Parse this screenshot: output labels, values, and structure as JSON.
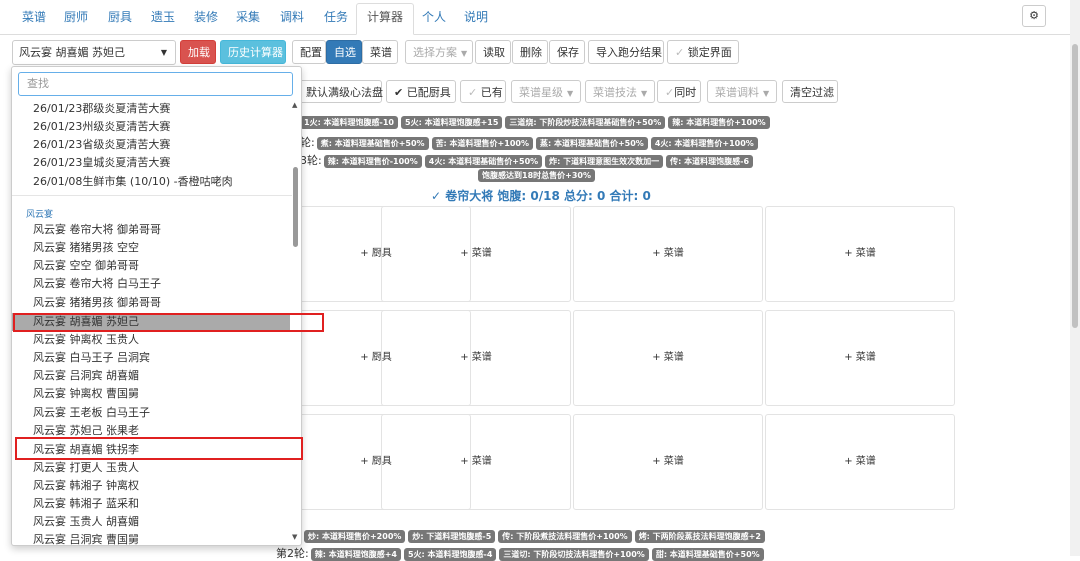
{
  "nav": {
    "tabs": [
      "菜谱",
      "厨师",
      "厨具",
      "遗玉",
      "装修",
      "采集",
      "调料",
      "任务",
      "计算器",
      "个人",
      "说明"
    ],
    "active_index": 8
  },
  "toolbar": {
    "select_value": "风云宴 胡喜媚 苏妲己",
    "load": "加载",
    "history": "历史计算器",
    "config": "配置",
    "autoselect": "自选",
    "recipe": "菜谱",
    "choose_plan": "选择方案",
    "read": "读取",
    "delete": "删除",
    "save": "保存",
    "import": "导入跑分结果",
    "lock": "锁定界面"
  },
  "filters": {
    "default_full": "默认满级心法盘",
    "equipped": "已配厨具",
    "owned": "已有",
    "recipe_star": "菜谱星级",
    "recipe_skill": "菜谱技法",
    "same_time": "同时",
    "recipe_seasoning": "菜谱调料",
    "clear": "清空过滤"
  },
  "rules": {
    "row1": [
      "1火: 本道料理饱腹感-10",
      "5火: 本道料理饱腹感+15",
      "三道烧: 下阶段炒技法料理基础售价+50%",
      "辣: 本道料理售价+100%"
    ],
    "row2_label": "轮:",
    "row2": [
      "煮: 本道料理基础售价+50%",
      "苦: 本道料理售价+100%",
      "蒸: 本道料理基础售价+50%",
      "4火: 本道料理售价+100%"
    ],
    "row3_label": "3轮:",
    "row3": [
      "辣: 本道料理售价-100%",
      "4火: 本道料理基础售价+50%",
      "炸: 下道料理意图生效次数加一",
      "传: 本道料理饱腹感-6"
    ],
    "row4": [
      "饱腹感达到18时总售价+30%"
    ],
    "bottom1": [
      "炒: 本道料理售价+200%",
      "炒: 下道料理饱腹感-5",
      "传: 下阶段煮技法料理售价+100%",
      "烤: 下两阶段蒸技法料理饱腹感+2"
    ],
    "bottom2_label": "第2轮:",
    "bottom2": [
      "辣: 本道料理饱腹感+4",
      "5火: 本道料理饱腹感-4",
      "三道切: 下阶段切技法料理售价+100%",
      "甜: 本道料理基础售价+50%"
    ]
  },
  "summary": "✓ 卷帘大将 饱腹: 0/18 总分: 0 合计: 0",
  "grid": {
    "equip_label": "+ 厨具",
    "recipe_label": "+ 菜谱"
  },
  "dropdown": {
    "search_placeholder": "查找",
    "items_top": [
      "26/01/23郡级炎夏清苦大赛",
      "26/01/23州级炎夏清苦大赛",
      "26/01/23省级炎夏清苦大赛",
      "26/01/23皇城炎夏清苦大赛",
      "26/01/08生鲜市集 (10/10) -香橙咕咾肉"
    ],
    "group_label": "风云宴",
    "items": [
      "风云宴 卷帘大将 御弟哥哥",
      "风云宴 猪猪男孩 空空",
      "风云宴 空空 御弟哥哥",
      "风云宴 卷帘大将 白马王子",
      "风云宴 猪猪男孩 御弟哥哥",
      "风云宴 胡喜媚 苏妲己",
      "风云宴 钟离权 玉贵人",
      "风云宴 白马王子 吕洞宾",
      "风云宴 吕洞宾 胡喜媚",
      "风云宴 钟离权 曹国舅",
      "风云宴 王老板 白马王子",
      "风云宴 苏妲己 张果老",
      "风云宴 胡喜媚 铁拐李",
      "风云宴 打更人 玉贵人",
      "风云宴 韩湘子 钟离权",
      "风云宴 韩湘子 蓝采和",
      "风云宴 玉贵人 胡喜媚",
      "风云宴 吕洞宾 曹国舅"
    ],
    "selected_index": 5
  },
  "colors": {
    "highlight": "#e02020",
    "accent": "#337ab7"
  }
}
